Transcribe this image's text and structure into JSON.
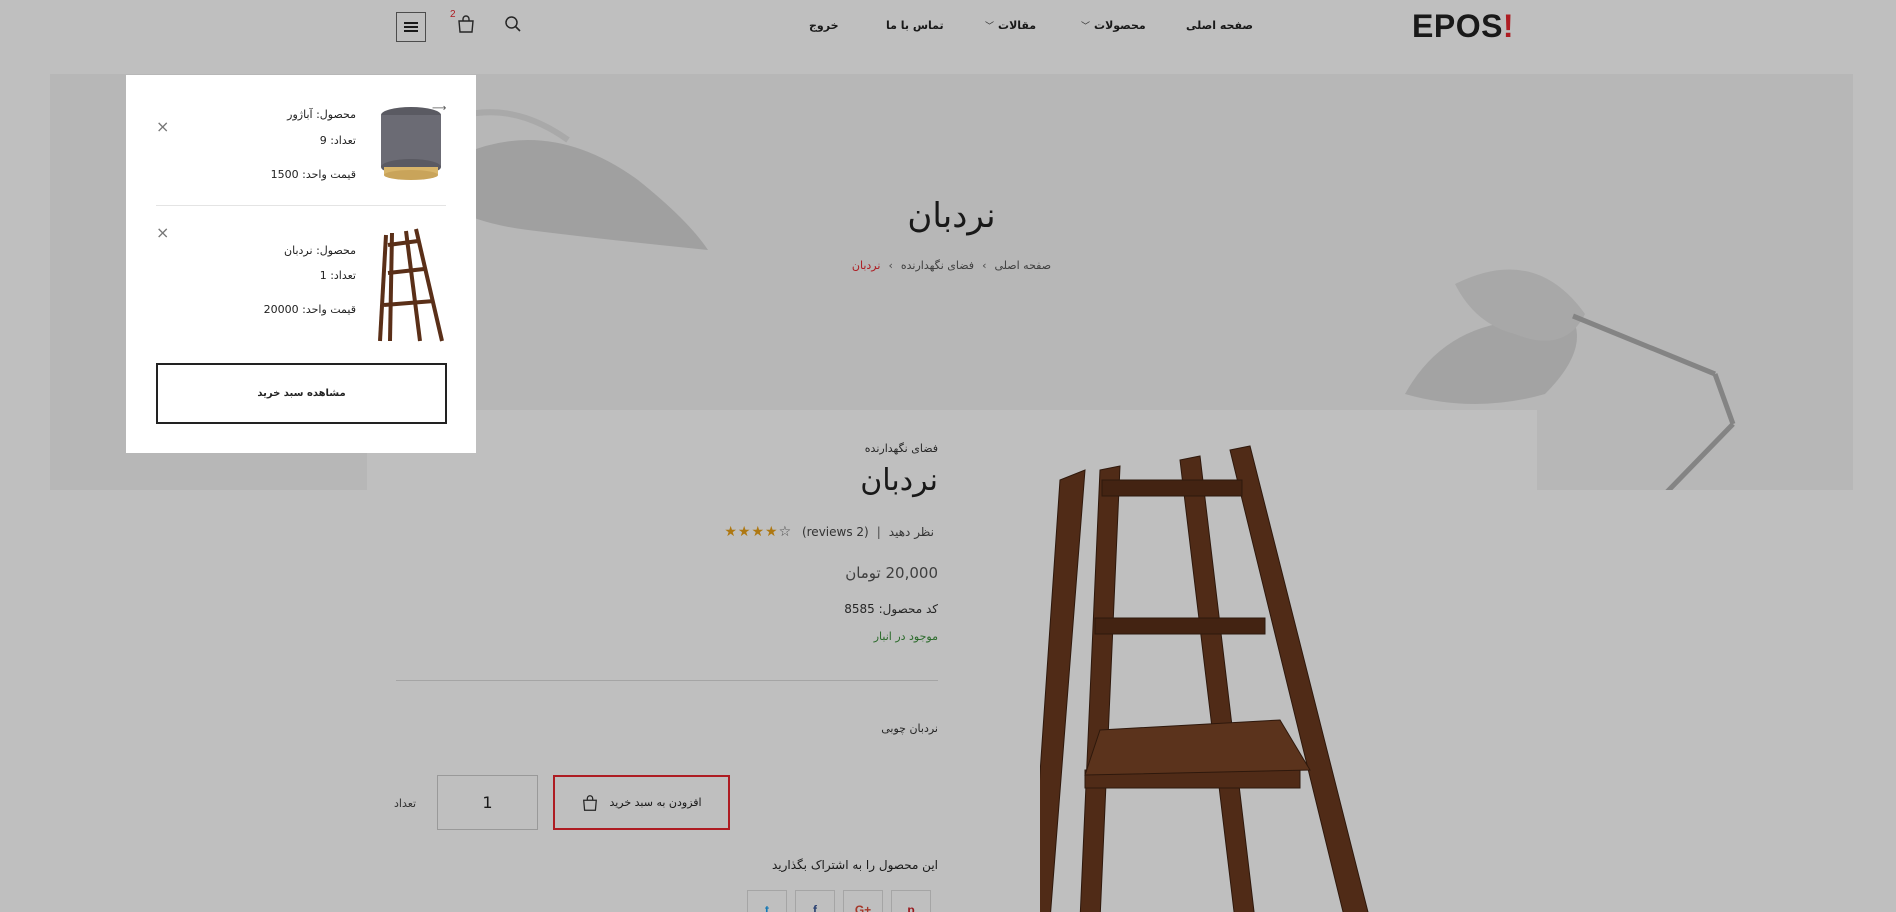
{
  "header": {
    "logo": "EPOS",
    "logo_mark": "!",
    "nav": {
      "home": "صفحه اصلی",
      "products": "محصولات",
      "articles": "مقالات",
      "contact": "تماس با ما",
      "logout": "خروج"
    },
    "cart_count": "2",
    "icons": {
      "menu": "menu-icon",
      "cart": "shopping-bag-icon",
      "search": "search-icon"
    }
  },
  "hero": {
    "title": "نردبان",
    "breadcrumb": [
      "صفحه اصلی",
      "فضای نگهدارنده",
      "نردبان"
    ],
    "breadcrumb_separator": "›"
  },
  "product": {
    "category": "فضای نگهدارنده",
    "title": "نردبان",
    "review_link": "نظر دهید",
    "reviews": "(2 reviews)",
    "rating": 4,
    "rating_max": 5,
    "price": "20,000 تومان",
    "sku_label": "کد محصول:",
    "sku": "8585",
    "stock": "موجود در انبار",
    "description": "نردبان چوبی",
    "qty_label": "تعداد",
    "qty_value": "1",
    "add_to_cart": "افزودن به سبد خرید",
    "share_label": "این محصول را به اشتراک بگذارید",
    "share": [
      "pinterest",
      "google-plus",
      "facebook",
      "twitter"
    ]
  },
  "mini_cart": {
    "items": [
      {
        "product_label": "محصول:",
        "product": "آباژور",
        "qty_label": "تعداد:",
        "qty": "9",
        "unit_price_label": "قیمت واحد:",
        "unit_price": "1500"
      },
      {
        "product_label": "محصول:",
        "product": "نردبان",
        "qty_label": "تعداد:",
        "qty": "1",
        "unit_price_label": "قیمت واحد:",
        "unit_price": "20000"
      }
    ],
    "remove_symbol": "×",
    "view_cart": "مشاهده سبد خرید"
  },
  "colors": {
    "accent": "#e8262e",
    "star": "#e8a019",
    "in_stock": "#3a8f3a"
  }
}
